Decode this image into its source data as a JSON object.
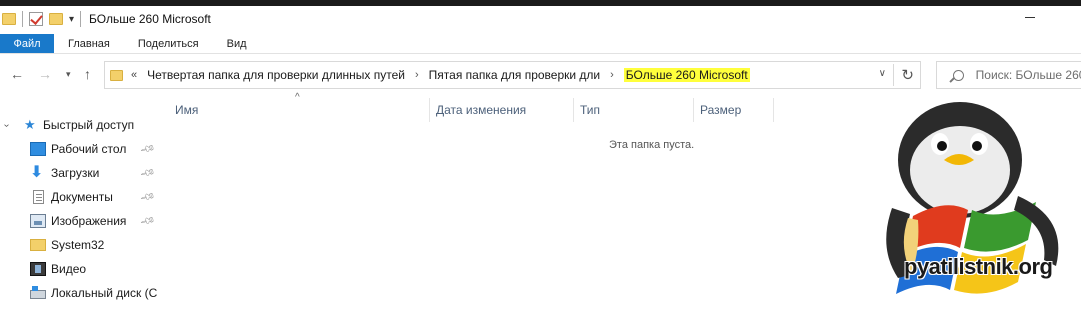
{
  "window": {
    "title": "БОльше 260 Microsoft"
  },
  "ribbon": {
    "tabs": [
      "Файл",
      "Главная",
      "Поделиться",
      "Вид"
    ]
  },
  "address": {
    "overflow": "«",
    "crumbs": [
      "Четвертая папка для проверки длинных путей",
      "Пятая папка для проверки дли",
      "БОльше 260 Microsoft"
    ],
    "highlight_color": "#ffff3c"
  },
  "search": {
    "placeholder": "Поиск: БОльше 260"
  },
  "columns": [
    "Имя",
    "Дата изменения",
    "Тип",
    "Размер"
  ],
  "empty_message": "Эта папка пуста.",
  "sidebar": {
    "quick_access": "Быстрый доступ",
    "items": [
      {
        "label": "Рабочий стол",
        "icon": "desktop-icon",
        "pinned": true
      },
      {
        "label": "Загрузки",
        "icon": "downloads-icon",
        "pinned": true
      },
      {
        "label": "Документы",
        "icon": "documents-icon",
        "pinned": true
      },
      {
        "label": "Изображения",
        "icon": "pictures-icon",
        "pinned": true
      },
      {
        "label": "System32",
        "icon": "folder-icon",
        "pinned": false
      },
      {
        "label": "Видео",
        "icon": "video-icon",
        "pinned": false
      },
      {
        "label": "Локальный диск (C",
        "icon": "disk-icon",
        "pinned": false
      }
    ]
  },
  "watermark": {
    "text": "pyatilistnik.org"
  },
  "colors": {
    "file_tab": "#1979ca",
    "accent": "#2c86d6"
  }
}
